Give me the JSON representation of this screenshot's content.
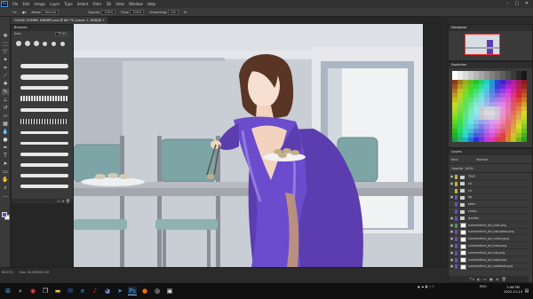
{
  "app": {
    "logo": "Ps",
    "menu": [
      "File",
      "Edit",
      "Image",
      "Layer",
      "Type",
      "Select",
      "Filter",
      "3D",
      "View",
      "Window",
      "Help"
    ]
  },
  "options": {
    "mode_label": "Mode:",
    "mode_value": "Normal",
    "opacity_label": "Opacity:",
    "opacity_value": "100%",
    "flow_label": "Flow:",
    "flow_value": "100%",
    "smoothing_label": "Smoothing:",
    "smoothing_value": "0%"
  },
  "document": {
    "tab_title": "CHASE ZOMBIE DINNER.psd @ 66.7% (Layer 1, RGB/8) *",
    "zoom": "66.67%",
    "doc_size": "Doc: 30.4M/682.2M"
  },
  "brushes": {
    "title": "Brushes",
    "size_label": "Size:",
    "size_value": "15 px"
  },
  "navigator": {
    "title": "Navigator"
  },
  "swatches": {
    "title": "Swatches"
  },
  "layers": {
    "title": "Layers",
    "kind_label": "Kind",
    "blend": "Normal",
    "opacity_label": "Opacity: 100%",
    "footer_icons": "fx ◐ ▭ ▣ ⊕ 🗑",
    "rows": [
      {
        "name": "TEXT",
        "type": "folder",
        "tag": "#c8b03c",
        "visible": true
      },
      {
        "name": "sd",
        "type": "folder",
        "tag": "#c8b03c",
        "visible": true
      },
      {
        "name": "cd",
        "type": "folder",
        "tag": "#c8b03c",
        "visible": false
      },
      {
        "name": "bg",
        "type": "folder",
        "tag": "#6a4fb2",
        "visible": true
      },
      {
        "name": "table",
        "type": "folder",
        "tag": "#6a4fb2",
        "visible": false
      },
      {
        "name": "chairs",
        "type": "folder",
        "tag": "#6a4fb2",
        "visible": false
      },
      {
        "name": "jennifer",
        "type": "folder",
        "tag": "#6a4fb2",
        "visible": true
      },
      {
        "name": "summertime_jen_robe.png",
        "type": "image",
        "tag": "#4c9a4a",
        "visible": true
      },
      {
        "name": "summertime_jen_hairplates.png",
        "type": "image",
        "tag": "#6a4fb2",
        "visible": true
      },
      {
        "name": "summertime_jen_cutlery.png",
        "type": "image",
        "tag": "#6a4fb2",
        "visible": true
      },
      {
        "name": "summertime_jen_head.png",
        "type": "image",
        "tag": "#6a4fb2",
        "visible": true
      },
      {
        "name": "summertime_jen_hair.png",
        "type": "image",
        "tag": "#6a4fb2",
        "visible": true
      },
      {
        "name": "summertime_jen_body.png",
        "type": "image",
        "tag": "#6a4fb2",
        "visible": true
      },
      {
        "name": "summertime_jen_robeback.png",
        "type": "image",
        "tag": "#6a4fb2",
        "visible": true
      }
    ]
  },
  "taskbar": {
    "tray_lang": "ENG",
    "time": "2:46 PM",
    "date": "2022-12-13"
  }
}
